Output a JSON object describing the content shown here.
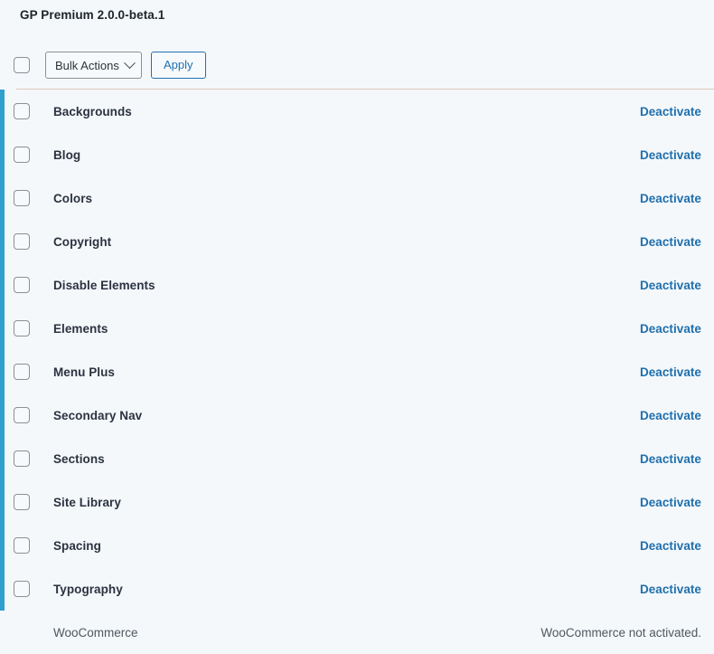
{
  "header": {
    "title": "GP Premium 2.0.0-beta.1"
  },
  "toolbar": {
    "select_all_checkbox": "select-all",
    "bulk_actions_label": "Bulk Actions",
    "bulk_actions_options": [
      "Bulk Actions"
    ],
    "apply_label": "Apply"
  },
  "colors": {
    "accent_bar": "#2f9fcc",
    "link": "#1f6fad",
    "divider": "#dfc8b9",
    "background": "#f4f8fb",
    "button_border": "#2271b1"
  },
  "modules": [
    {
      "name": "Backgrounds",
      "action": "Deactivate"
    },
    {
      "name": "Blog",
      "action": "Deactivate"
    },
    {
      "name": "Colors",
      "action": "Deactivate"
    },
    {
      "name": "Copyright",
      "action": "Deactivate"
    },
    {
      "name": "Disable Elements",
      "action": "Deactivate"
    },
    {
      "name": "Elements",
      "action": "Deactivate"
    },
    {
      "name": "Menu Plus",
      "action": "Deactivate"
    },
    {
      "name": "Secondary Nav",
      "action": "Deactivate"
    },
    {
      "name": "Sections",
      "action": "Deactivate"
    },
    {
      "name": "Site Library",
      "action": "Deactivate"
    },
    {
      "name": "Spacing",
      "action": "Deactivate"
    },
    {
      "name": "Typography",
      "action": "Deactivate"
    }
  ],
  "inactive_modules": [
    {
      "name": "WooCommerce",
      "status": "WooCommerce not activated."
    }
  ]
}
